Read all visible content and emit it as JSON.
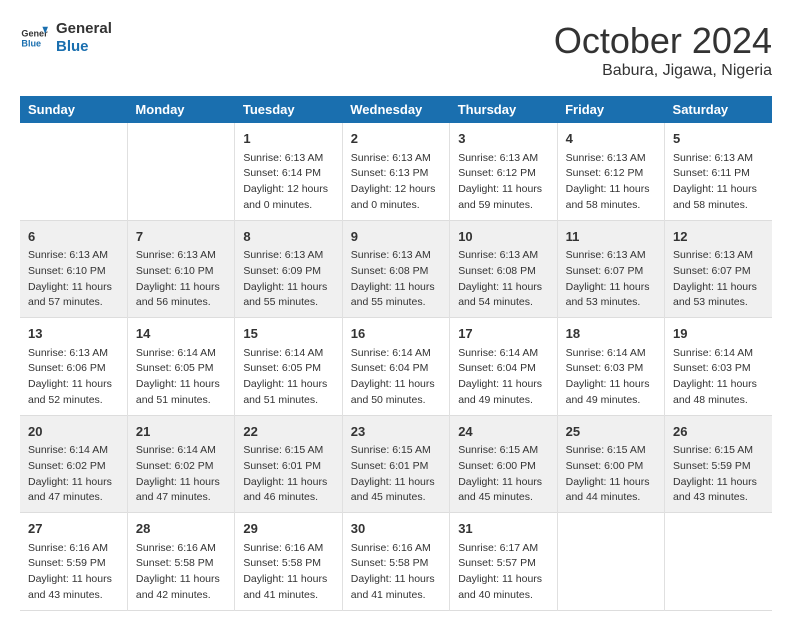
{
  "header": {
    "logo_line1": "General",
    "logo_line2": "Blue",
    "month": "October 2024",
    "location": "Babura, Jigawa, Nigeria"
  },
  "columns": [
    "Sunday",
    "Monday",
    "Tuesday",
    "Wednesday",
    "Thursday",
    "Friday",
    "Saturday"
  ],
  "rows": [
    [
      {
        "num": "",
        "info": ""
      },
      {
        "num": "",
        "info": ""
      },
      {
        "num": "1",
        "info": "Sunrise: 6:13 AM\nSunset: 6:14 PM\nDaylight: 12 hours\nand 0 minutes."
      },
      {
        "num": "2",
        "info": "Sunrise: 6:13 AM\nSunset: 6:13 PM\nDaylight: 12 hours\nand 0 minutes."
      },
      {
        "num": "3",
        "info": "Sunrise: 6:13 AM\nSunset: 6:12 PM\nDaylight: 11 hours\nand 59 minutes."
      },
      {
        "num": "4",
        "info": "Sunrise: 6:13 AM\nSunset: 6:12 PM\nDaylight: 11 hours\nand 58 minutes."
      },
      {
        "num": "5",
        "info": "Sunrise: 6:13 AM\nSunset: 6:11 PM\nDaylight: 11 hours\nand 58 minutes."
      }
    ],
    [
      {
        "num": "6",
        "info": "Sunrise: 6:13 AM\nSunset: 6:10 PM\nDaylight: 11 hours\nand 57 minutes."
      },
      {
        "num": "7",
        "info": "Sunrise: 6:13 AM\nSunset: 6:10 PM\nDaylight: 11 hours\nand 56 minutes."
      },
      {
        "num": "8",
        "info": "Sunrise: 6:13 AM\nSunset: 6:09 PM\nDaylight: 11 hours\nand 55 minutes."
      },
      {
        "num": "9",
        "info": "Sunrise: 6:13 AM\nSunset: 6:08 PM\nDaylight: 11 hours\nand 55 minutes."
      },
      {
        "num": "10",
        "info": "Sunrise: 6:13 AM\nSunset: 6:08 PM\nDaylight: 11 hours\nand 54 minutes."
      },
      {
        "num": "11",
        "info": "Sunrise: 6:13 AM\nSunset: 6:07 PM\nDaylight: 11 hours\nand 53 minutes."
      },
      {
        "num": "12",
        "info": "Sunrise: 6:13 AM\nSunset: 6:07 PM\nDaylight: 11 hours\nand 53 minutes."
      }
    ],
    [
      {
        "num": "13",
        "info": "Sunrise: 6:13 AM\nSunset: 6:06 PM\nDaylight: 11 hours\nand 52 minutes."
      },
      {
        "num": "14",
        "info": "Sunrise: 6:14 AM\nSunset: 6:05 PM\nDaylight: 11 hours\nand 51 minutes."
      },
      {
        "num": "15",
        "info": "Sunrise: 6:14 AM\nSunset: 6:05 PM\nDaylight: 11 hours\nand 51 minutes."
      },
      {
        "num": "16",
        "info": "Sunrise: 6:14 AM\nSunset: 6:04 PM\nDaylight: 11 hours\nand 50 minutes."
      },
      {
        "num": "17",
        "info": "Sunrise: 6:14 AM\nSunset: 6:04 PM\nDaylight: 11 hours\nand 49 minutes."
      },
      {
        "num": "18",
        "info": "Sunrise: 6:14 AM\nSunset: 6:03 PM\nDaylight: 11 hours\nand 49 minutes."
      },
      {
        "num": "19",
        "info": "Sunrise: 6:14 AM\nSunset: 6:03 PM\nDaylight: 11 hours\nand 48 minutes."
      }
    ],
    [
      {
        "num": "20",
        "info": "Sunrise: 6:14 AM\nSunset: 6:02 PM\nDaylight: 11 hours\nand 47 minutes."
      },
      {
        "num": "21",
        "info": "Sunrise: 6:14 AM\nSunset: 6:02 PM\nDaylight: 11 hours\nand 47 minutes."
      },
      {
        "num": "22",
        "info": "Sunrise: 6:15 AM\nSunset: 6:01 PM\nDaylight: 11 hours\nand 46 minutes."
      },
      {
        "num": "23",
        "info": "Sunrise: 6:15 AM\nSunset: 6:01 PM\nDaylight: 11 hours\nand 45 minutes."
      },
      {
        "num": "24",
        "info": "Sunrise: 6:15 AM\nSunset: 6:00 PM\nDaylight: 11 hours\nand 45 minutes."
      },
      {
        "num": "25",
        "info": "Sunrise: 6:15 AM\nSunset: 6:00 PM\nDaylight: 11 hours\nand 44 minutes."
      },
      {
        "num": "26",
        "info": "Sunrise: 6:15 AM\nSunset: 5:59 PM\nDaylight: 11 hours\nand 43 minutes."
      }
    ],
    [
      {
        "num": "27",
        "info": "Sunrise: 6:16 AM\nSunset: 5:59 PM\nDaylight: 11 hours\nand 43 minutes."
      },
      {
        "num": "28",
        "info": "Sunrise: 6:16 AM\nSunset: 5:58 PM\nDaylight: 11 hours\nand 42 minutes."
      },
      {
        "num": "29",
        "info": "Sunrise: 6:16 AM\nSunset: 5:58 PM\nDaylight: 11 hours\nand 41 minutes."
      },
      {
        "num": "30",
        "info": "Sunrise: 6:16 AM\nSunset: 5:58 PM\nDaylight: 11 hours\nand 41 minutes."
      },
      {
        "num": "31",
        "info": "Sunrise: 6:17 AM\nSunset: 5:57 PM\nDaylight: 11 hours\nand 40 minutes."
      },
      {
        "num": "",
        "info": ""
      },
      {
        "num": "",
        "info": ""
      }
    ]
  ]
}
